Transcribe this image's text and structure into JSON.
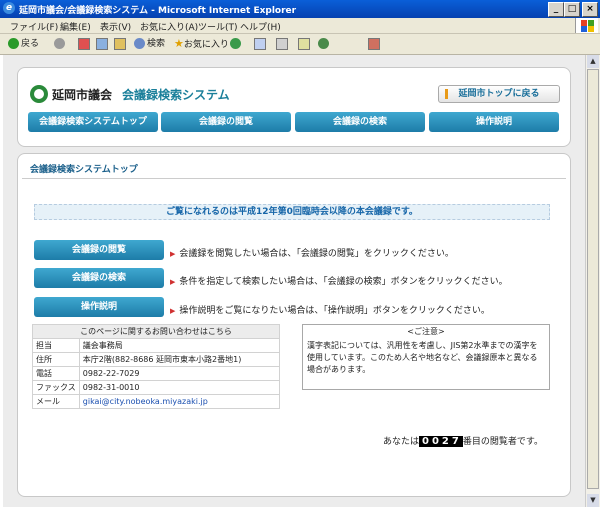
{
  "window": {
    "title": "延岡市議会/会議録検索システム - Microsoft Internet Explorer",
    "buttons": [
      "_",
      "□",
      "×"
    ]
  },
  "menu": [
    "ファイル(F)",
    "編集(E)",
    "表示(V)",
    "お気に入り(A)",
    "ツール(T)",
    "ヘルプ(H)"
  ],
  "toolbar": {
    "back": "戻る",
    "search": "検索",
    "favorites": "お気に入り"
  },
  "header": {
    "org": "延岡市議会",
    "system": "会議録検索システム",
    "home_button": "延岡市トップに戻る",
    "nav": [
      "会議録検索システムトップ",
      "会議録の閲覧",
      "会議録の検索",
      "操作説明"
    ]
  },
  "main": {
    "section_title": "会議録検索システムトップ",
    "notice": "ご覧になれるのは平成12年第0回臨時会以降の本会議録です。",
    "actions": [
      {
        "label": "会議録の閲覧",
        "desc": "会議録を閲覧したい場合は、「会議録の閲覧」をクリックください。"
      },
      {
        "label": "会議録の検索",
        "desc": "条件を指定して検索したい場合は、「会議録の検索」ボタンをクリックください。"
      },
      {
        "label": "操作説明",
        "desc": "操作説明をご覧になりたい場合は、「操作説明」ボタンをクリックください。"
      }
    ],
    "contact": {
      "heading": "このページに関するお問い合わせはこちら",
      "rows": [
        {
          "key": "担当",
          "value": "議会事務局"
        },
        {
          "key": "住所",
          "value": "本庁2階(882-8686 延岡市東本小路2番地1)"
        },
        {
          "key": "電話",
          "value": "0982-22-7029"
        },
        {
          "key": "ファックス",
          "value": "0982-31-0010"
        },
        {
          "key": "メール",
          "value": "gikai@city.nobeoka.miyazaki.jp"
        }
      ]
    },
    "caution": {
      "title": "<ご注意>",
      "body": "漢字表記については、汎用性を考慮し、JIS第2水準までの漢字を使用しています。このため人名や地名など、会議録原本と異なる場合があります。"
    },
    "counter": {
      "prefix": "あなたは",
      "number": "0027",
      "suffix": "番目の閲覧者です。"
    }
  },
  "colors": {
    "accent": "#1d7ca8",
    "title_bar": "#0a5fd8",
    "notice_text": "#1565a8"
  }
}
